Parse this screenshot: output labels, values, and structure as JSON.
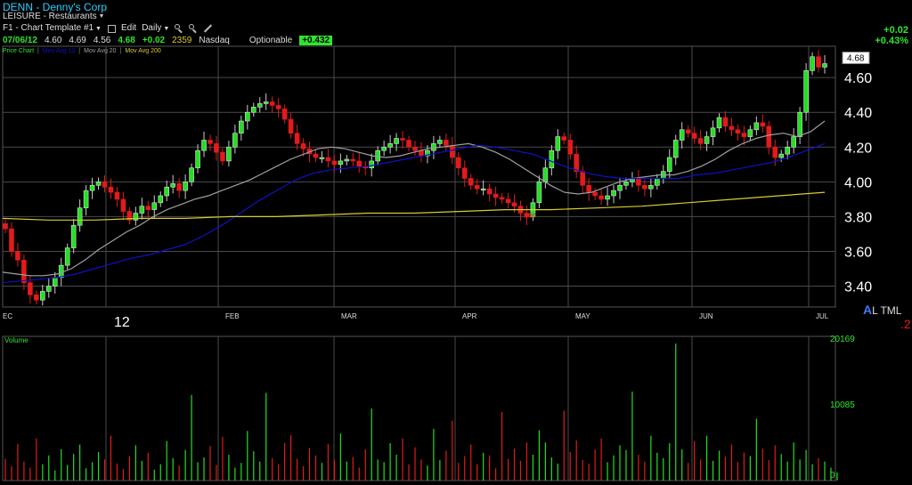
{
  "header": {
    "ticker": "DENN - Denny's Corp",
    "sector": "LEISURE - Restaurants",
    "toolbar": {
      "template": "F1 - Chart Template #1",
      "edit": "Edit",
      "period": "Daily"
    },
    "quote": {
      "date": "07/06/12",
      "open": "4.60",
      "high": "4.69",
      "low": "4.56",
      "close": "4.68",
      "change": "+0.02",
      "volume": "2359",
      "exchange": "Nasdaq",
      "optionable": "Optionable",
      "badge": "+0.432"
    },
    "change_abs": "+0.02",
    "change_pct": "+0.43%",
    "legend": {
      "price": "Price Chart",
      "ma10": "Mov Avg 10",
      "ma20": "Mov Avg 20",
      "ma200": "Mov Avg 200"
    }
  },
  "watermark": {
    "a": "A",
    "rest": "L TML"
  },
  "corner_mark": ".2",
  "year_label": "12",
  "colors": {
    "up": "#22e022",
    "down": "#e31b1b",
    "ma10": "#1010c8",
    "ma20": "#a0a0a0",
    "ma200": "#d8cc30",
    "grid": "#4a4a4a",
    "accent": "#28d2ff"
  },
  "icons": [
    "zoom-in-icon",
    "zoom-out-icon",
    "pencil-icon",
    "chevron-down-icon"
  ],
  "chart_data": [
    {
      "type": "candlestick",
      "title": "DENN - Denny's Corp",
      "ylim": [
        3.28,
        4.78
      ],
      "y_ticks": [
        "4.60",
        "4.40",
        "4.20",
        "4.00",
        "3.80",
        "3.60",
        "3.40"
      ],
      "x_ticks": [
        "EC",
        "FEB",
        "MAR",
        "APR",
        "MAY",
        "JUN",
        "JUL"
      ],
      "last_price_label": "4.68",
      "low_annotation": "3.80",
      "series": [
        {
          "name": "Price Chart",
          "close": [
            3.73,
            3.6,
            3.55,
            3.42,
            3.35,
            3.32,
            3.37,
            3.4,
            3.45,
            3.52,
            3.62,
            3.75,
            3.85,
            3.95,
            3.98,
            4.0,
            3.97,
            3.94,
            3.9,
            3.83,
            3.78,
            3.82,
            3.86,
            3.84,
            3.88,
            3.92,
            3.97,
            3.99,
            3.95,
            4.0,
            4.08,
            4.18,
            4.24,
            4.22,
            4.17,
            4.12,
            4.2,
            4.28,
            4.35,
            4.4,
            4.43,
            4.45,
            4.46,
            4.44,
            4.42,
            4.36,
            4.28,
            4.22,
            4.19,
            4.16,
            4.14,
            4.14,
            4.12,
            4.1,
            4.12,
            4.13,
            4.12,
            4.09,
            4.08,
            4.12,
            4.18,
            4.2,
            4.22,
            4.25,
            4.24,
            4.2,
            4.18,
            4.15,
            4.18,
            4.22,
            4.24,
            4.21,
            4.14,
            4.08,
            4.02,
            3.98,
            3.96,
            3.96,
            3.93,
            3.91,
            3.9,
            3.88,
            3.86,
            3.82,
            3.8,
            3.88,
            4.0,
            4.08,
            4.18,
            4.26,
            4.24,
            4.16,
            4.06,
            3.98,
            3.94,
            3.92,
            3.9,
            3.92,
            3.95,
            3.98,
            4.0,
            4.02,
            3.98,
            3.96,
            3.98,
            4.02,
            4.06,
            4.14,
            4.24,
            4.3,
            4.28,
            4.25,
            4.22,
            4.26,
            4.31,
            4.37,
            4.32,
            4.3,
            4.28,
            4.26,
            4.3,
            4.34,
            4.32,
            4.2,
            4.14,
            4.16,
            4.2,
            4.26,
            4.4,
            4.64,
            4.72,
            4.66,
            4.68
          ]
        },
        {
          "name": "Mov Avg 10",
          "values": [
            3.48,
            3.47,
            3.46,
            3.46,
            3.47,
            3.5,
            3.55,
            3.61,
            3.66,
            3.71,
            3.75,
            3.8,
            3.84,
            3.87,
            3.9,
            3.92,
            3.95,
            3.98,
            4.01,
            4.05,
            4.09,
            4.13,
            4.16,
            4.19,
            4.2,
            4.19,
            4.17,
            4.15,
            4.14,
            4.15,
            4.17,
            4.19,
            4.2,
            4.21,
            4.22,
            4.2,
            4.17,
            4.13,
            4.08,
            4.03,
            3.98,
            3.94,
            3.93,
            3.94,
            3.97,
            4.0,
            4.02,
            4.03,
            4.04,
            4.04,
            4.06,
            4.09,
            4.13,
            4.18,
            4.22,
            4.25,
            4.27,
            4.28,
            4.26,
            4.29,
            4.35
          ]
        },
        {
          "name": "Mov Avg 20",
          "values": [
            3.42,
            3.43,
            3.44,
            3.45,
            3.47,
            3.5,
            3.53,
            3.56,
            3.58,
            3.61,
            3.64,
            3.69,
            3.75,
            3.82,
            3.89,
            3.95,
            4.01,
            4.05,
            4.07,
            4.08,
            4.09,
            4.11,
            4.13,
            4.15,
            4.17,
            4.19,
            4.21,
            4.2,
            4.18,
            4.16,
            4.12,
            4.08,
            4.05,
            4.03,
            4.02,
            4.02,
            4.02,
            4.02,
            4.04,
            4.05,
            4.07,
            4.09,
            4.11,
            4.14,
            4.18,
            4.22
          ]
        },
        {
          "name": "Mov Avg 200",
          "values": [
            3.79,
            3.78,
            3.78,
            3.79,
            3.79,
            3.8,
            3.8,
            3.81,
            3.82,
            3.82,
            3.83,
            3.84,
            3.84,
            3.85,
            3.86,
            3.88,
            3.9,
            3.92,
            3.94
          ]
        }
      ]
    },
    {
      "type": "bar",
      "title": "Volume",
      "y_ticks": [
        "20169",
        "10085",
        "0"
      ],
      "ylim": [
        0,
        20169
      ],
      "values": [
        3200,
        2100,
        5400,
        2800,
        1900,
        6200,
        2400,
        3700,
        1500,
        4600,
        2300,
        3900,
        5300,
        1800,
        2700,
        4200,
        3100,
        6600,
        2500,
        1700,
        3600,
        5200,
        2900,
        4100,
        1600,
        2400,
        5800,
        3300,
        2200,
        4500,
        12600,
        2700,
        3400,
        5100,
        2300,
        6400,
        3800,
        1900,
        2600,
        7300,
        4300,
        2800,
        12900,
        3300,
        2400,
        5500,
        6700,
        3200,
        2100,
        4800,
        3700,
        2600,
        5400,
        3000,
        6900,
        2800,
        3500,
        1900,
        4600,
        10600,
        3100,
        2700,
        5500,
        3800,
        6200,
        2400,
        4900,
        3100,
        2200,
        7600,
        3000,
        4400,
        8800,
        2600,
        3600,
        5300,
        2400,
        4100,
        3700,
        1800,
        10100,
        3200,
        4700,
        2900,
        5600,
        3800,
        7400,
        5600,
        3400,
        2500,
        10300,
        4200,
        5900,
        3000,
        2500,
        4600,
        6200,
        2700,
        3700,
        5200,
        4500,
        13100,
        3800,
        2800,
        6600,
        4100,
        3300,
        5500,
        20169,
        4600,
        2600,
        5800,
        3100,
        6600,
        2900,
        4400,
        3500,
        5300,
        2700,
        4100,
        3600,
        9100,
        4700,
        3000,
        5200,
        3900,
        2800,
        5600,
        3100,
        4500,
        2400,
        3300,
        2800,
        1900,
        1200
      ]
    }
  ]
}
